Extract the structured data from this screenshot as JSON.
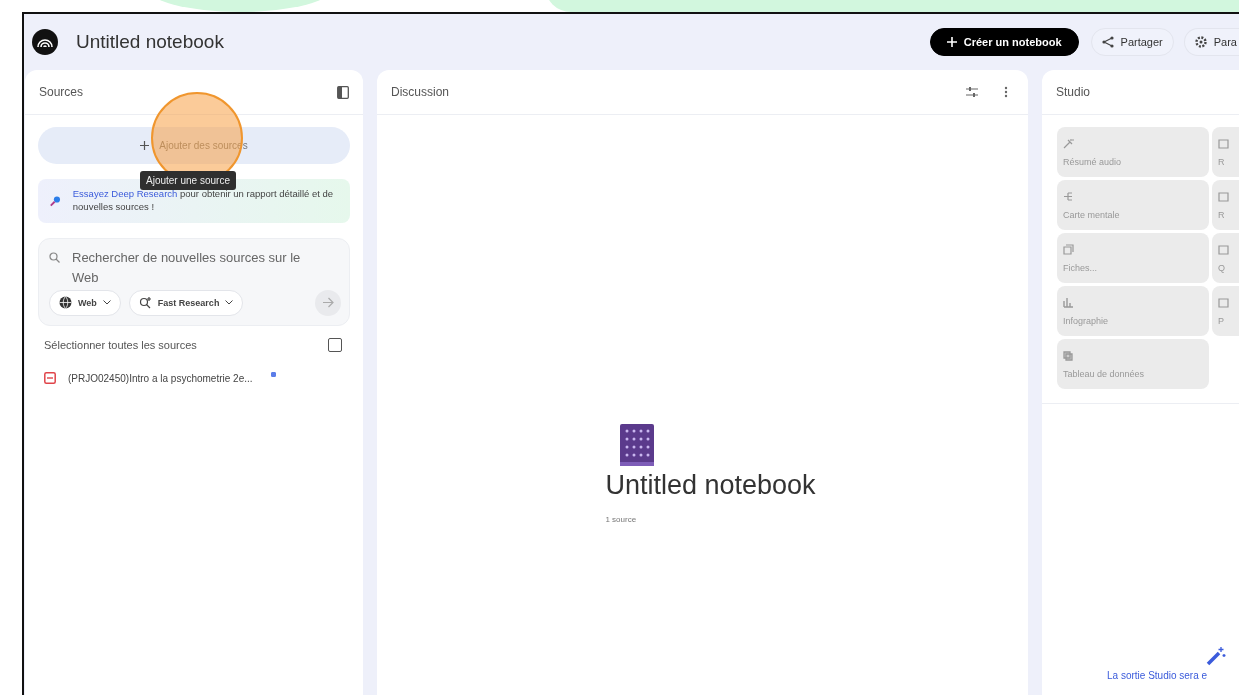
{
  "app": {
    "title": "Untitled notebook"
  },
  "header_actions": [
    {
      "kind": "primary",
      "label": "Créer un notebook"
    },
    {
      "kind": "share",
      "label": "Partager"
    },
    {
      "kind": "settings",
      "label": "Para"
    }
  ],
  "sources": {
    "title": "Sources",
    "add_button": "Ajouter des sources",
    "tooltip": "Ajouter une source",
    "promo": {
      "link": "Essayez Deep Research",
      "text": "pour obtenir un rapport détaillé et de nouvelles sources !"
    },
    "search": {
      "placeholder": "Rechercher de nouvelles sources sur le Web",
      "chips": [
        {
          "kind": "globe",
          "label": "Web"
        },
        {
          "kind": "research",
          "label": "Fast Research"
        }
      ]
    },
    "select_all": {
      "label": "Sélectionner toutes les sources",
      "checked": false
    },
    "items": [
      {
        "name": "(PRJO02450)Intro a la psychometrie 2e...",
        "checked": true
      }
    ]
  },
  "discussion": {
    "title": "Discussion",
    "notebook_title": "Untitled notebook",
    "source_count": "1 source"
  },
  "studio": {
    "title": "Studio",
    "tiles": [
      {
        "kind": "audio",
        "label": "Résumé audio"
      },
      {
        "kind": "video",
        "label": "R"
      },
      {
        "kind": "mindmap",
        "label": "Carte mentale"
      },
      {
        "kind": "report",
        "label": "R"
      },
      {
        "kind": "cards",
        "label": "Fiches..."
      },
      {
        "kind": "quiz",
        "label": "Q"
      },
      {
        "kind": "chart",
        "label": "Infographie"
      },
      {
        "kind": "slides",
        "label": "P"
      },
      {
        "kind": "table",
        "label": "Tableau de données"
      }
    ],
    "output_note": "La sortie Studio sera e"
  }
}
